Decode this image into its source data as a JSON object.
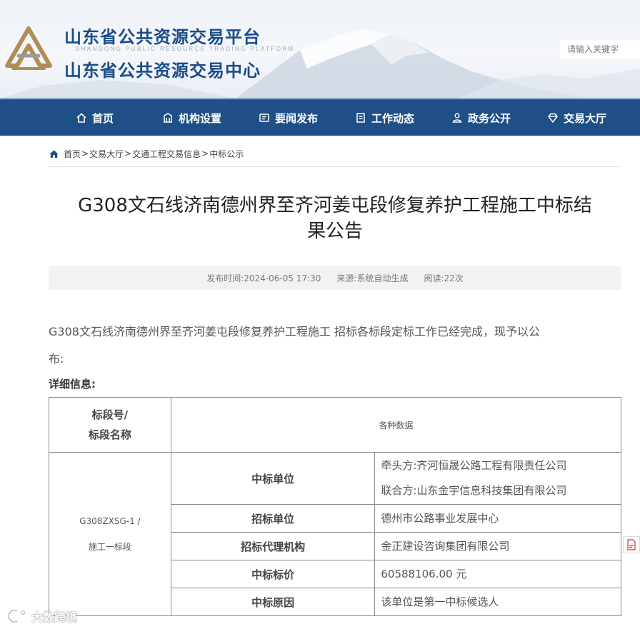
{
  "header": {
    "title_line1": "山东省公共资源交易平台",
    "subtitle_en": "SHANDONG PUBLIC RESOURCE TRADING PLATFORM",
    "title_line2": "山东省公共资源交易中心",
    "logo_icon": "ribbon-logo-icon",
    "search": {
      "placeholder": "请输入关键字",
      "value": ""
    }
  },
  "nav": {
    "items": [
      {
        "label": "首页",
        "icon": "home-icon"
      },
      {
        "label": "机构设置",
        "icon": "building-icon"
      },
      {
        "label": "要闻发布",
        "icon": "news-icon"
      },
      {
        "label": "工作动态",
        "icon": "document-icon"
      },
      {
        "label": "政务公开",
        "icon": "person-icon"
      },
      {
        "label": "交易大厅",
        "icon": "diamond-icon"
      }
    ]
  },
  "breadcrumb": {
    "items": [
      "首页",
      "交易大厅",
      "交通工程交易信息",
      "中标公示"
    ],
    "separator": ">"
  },
  "article": {
    "title_line1": "G308文石线济南德州界至齐河姜屯段修复养护工程施工中标结",
    "title_line2": "果公告",
    "meta": {
      "publish_label": "发布时间:",
      "publish_time": "2024-06-05 17:30",
      "source_label": "来源:",
      "source": "系统自动生成",
      "reads_label": "阅读:",
      "reads": "22次"
    },
    "intro_line1": "G308文石线济南德州界至齐河姜屯段修复养护工程施工 招标各标段定标工作已经完成，现予以公",
    "intro_line2": "布:",
    "detail_heading": "详细信息:"
  },
  "table": {
    "header_col1_line1": "标段号/",
    "header_col1_line2": "标段名称",
    "header_col2": "各种数据",
    "bid_section_line1": "G308ZXSG-1 /",
    "bid_section_line2": "施工一标段",
    "rows": [
      {
        "label": "中标单位",
        "value_line1": "牵头方:齐河恒晟公路工程有限责任公司",
        "value_line2": "联合方:山东金宇信息科技集团有限公司"
      },
      {
        "label": "招标单位",
        "value": "德州市公路事业发展中心"
      },
      {
        "label": "招标代理机构",
        "value": "金正建设咨询集团有限公司"
      },
      {
        "label": "中标标价",
        "value": "60588106.00 元"
      },
      {
        "label": "中标原因",
        "value": "该单位是第一中标候选人"
      }
    ]
  },
  "watermark": {
    "text": "大数跨境",
    "icon": "brand-c-icon"
  },
  "colors": {
    "nav_bg": "#1e4f87",
    "title_blue": "#1b4c8a",
    "meta_bg": "#f2f2f2"
  }
}
